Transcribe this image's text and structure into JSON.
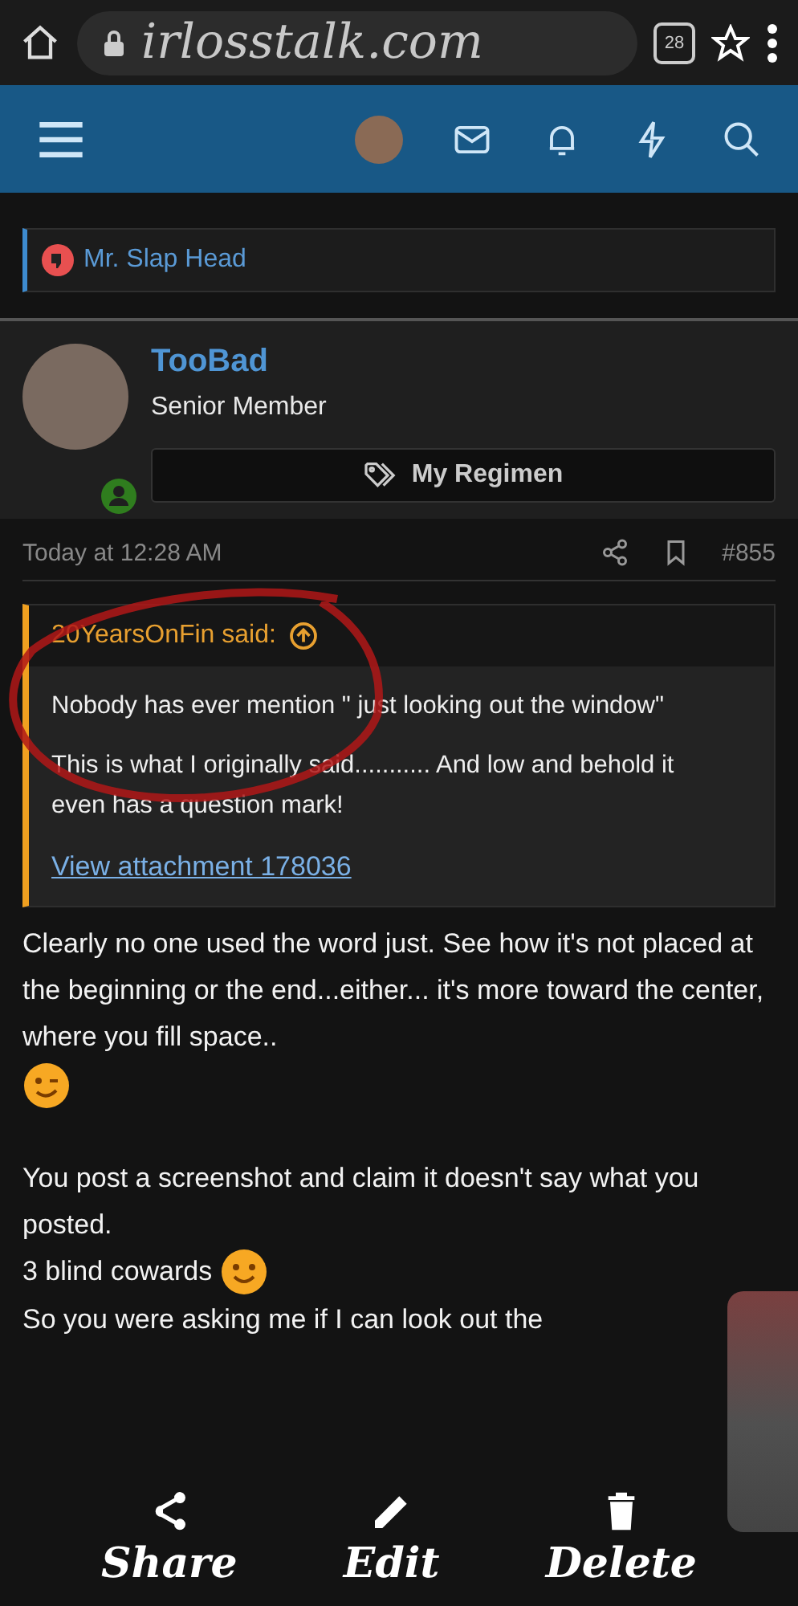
{
  "browser": {
    "url": "irlosstalk.com",
    "tab_count": "28"
  },
  "breadcrumb": {
    "label": "Mr. Slap Head"
  },
  "post": {
    "author": "TooBad",
    "role": "Senior Member",
    "online": true,
    "banner": "My Regimen",
    "date": "Today at 12:28 AM",
    "number": "#855",
    "quote": {
      "author": "20YearsOnFin said:",
      "paragraphs": [
        "Nobody has ever mention \" just looking out the window\"",
        "This is what I originally said........... And low and behold it even has a question mark!"
      ],
      "link": "View attachment 178036"
    },
    "body": [
      {
        "lines": [
          {
            "kind": "wink",
            "text": "Clearly no one used the word just. See how it's not placed at the beginning or the end...either... it's more toward the center, where you fill space.."
          }
        ]
      },
      {
        "lines": [
          {
            "kind": "plain",
            "text": "You post a screenshot and claim it doesn't say what you posted."
          },
          {
            "kind": "smile",
            "text": "3 blind cowards"
          }
        ]
      },
      {
        "lines": [
          {
            "kind": "plain",
            "text": "So you were asking me if I can look out the"
          }
        ]
      }
    ]
  },
  "actions": [
    {
      "kind": "share",
      "label": "Share"
    },
    {
      "kind": "edit",
      "label": "Edit"
    },
    {
      "kind": "delete",
      "label": "Delete"
    }
  ]
}
